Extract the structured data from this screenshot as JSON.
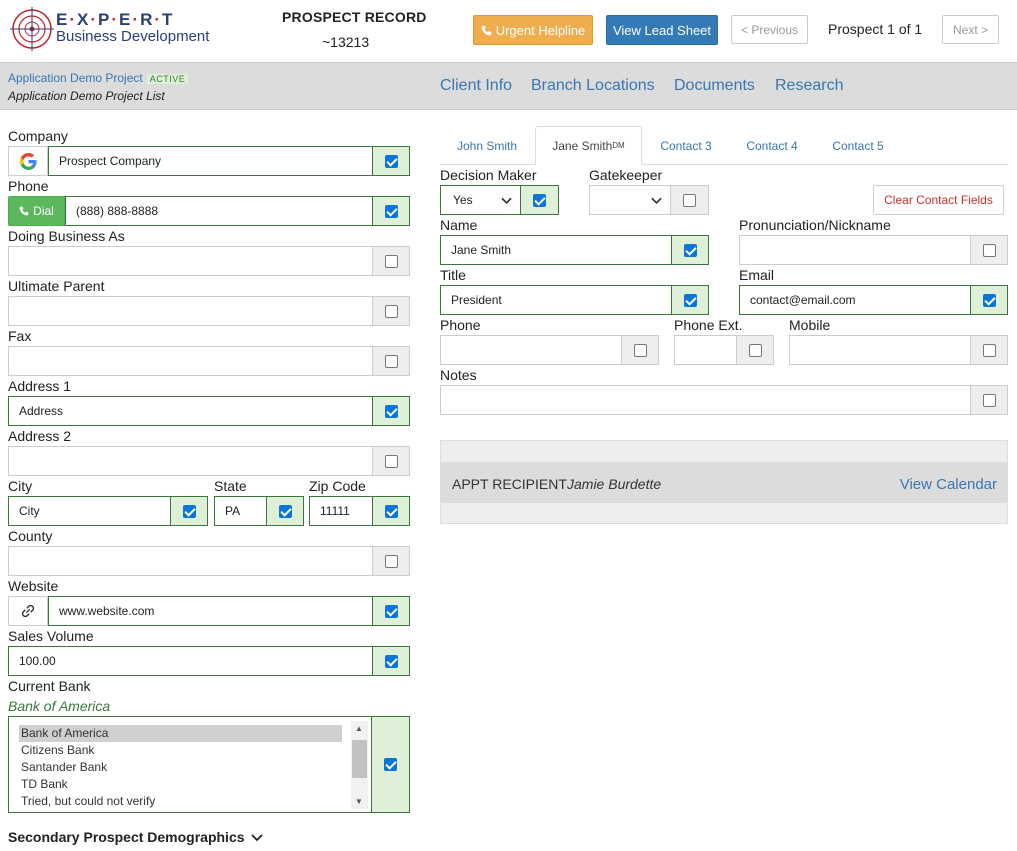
{
  "header": {
    "logo_line1": "E·X·P·E·R·T",
    "logo_line2": "Business Development",
    "record_title": "PROSPECT RECORD",
    "record_id": "~13213",
    "urgent_label": "Urgent Helpline",
    "lead_sheet_label": "View Lead Sheet",
    "previous_label": "< Previous",
    "prospect_count": "Prospect 1 of 1",
    "next_label": "Next >"
  },
  "subbar": {
    "project_name": "Application Demo Project",
    "project_status": "ACTIVE",
    "project_list": "Application Demo Project List",
    "nav": [
      "Client Info",
      "Branch Locations",
      "Documents",
      "Research"
    ]
  },
  "company_form": {
    "company_label": "Company",
    "company_value": "Prospect Company",
    "phone_label": "Phone",
    "dial_label": "Dial",
    "phone_value": "(888) 888-8888",
    "dba_label": "Doing Business As",
    "ultimate_parent_label": "Ultimate Parent",
    "fax_label": "Fax",
    "address1_label": "Address 1",
    "address1_value": "Address",
    "address2_label": "Address 2",
    "city_label": "City",
    "city_value": "City",
    "state_label": "State",
    "state_value": "PA",
    "zip_label": "Zip Code",
    "zip_value": "11111",
    "county_label": "County",
    "website_label": "Website",
    "website_value": "www.website.com",
    "sales_volume_label": "Sales Volume",
    "sales_volume_value": "100.00",
    "current_bank_label": "Current Bank",
    "current_bank_selected": "Bank of America",
    "bank_options": [
      "Bank of America",
      "Citizens Bank",
      "Santander Bank",
      "TD Bank",
      "Tried, but could not verify"
    ],
    "secondary_label": "Secondary Prospect Demographics"
  },
  "contact_tabs": {
    "tabs": [
      "John Smith",
      "Jane Smith",
      "Contact 3",
      "Contact 4",
      "Contact 5"
    ],
    "dm_marker": "DM",
    "active_index": 1
  },
  "contact_form": {
    "decision_maker_label": "Decision Maker",
    "decision_maker_value": "Yes",
    "gatekeeper_label": "Gatekeeper",
    "clear_label": "Clear Contact Fields",
    "name_label": "Name",
    "name_value": "Jane Smith",
    "pronunciation_label": "Pronunciation/Nickname",
    "title_label": "Title",
    "title_value": "President",
    "email_label": "Email",
    "email_value": "contact@email.com",
    "phone_label": "Phone",
    "phone_ext_label": "Phone Ext.",
    "mobile_label": "Mobile",
    "notes_label": "Notes"
  },
  "appointment": {
    "label": "APPT RECIPIENT",
    "name": "Jamie Burdette",
    "calendar_link": "View Calendar"
  },
  "colors": {
    "brand_navy": "#2b3f73",
    "brand_red": "#c0262d",
    "link_blue": "#3a76b0",
    "valid_green": "#3c763d",
    "valid_bg": "#dff0d8",
    "warning_orange": "#f0ad4e",
    "primary_blue": "#337ab7",
    "dial_green": "#5cb85c"
  }
}
